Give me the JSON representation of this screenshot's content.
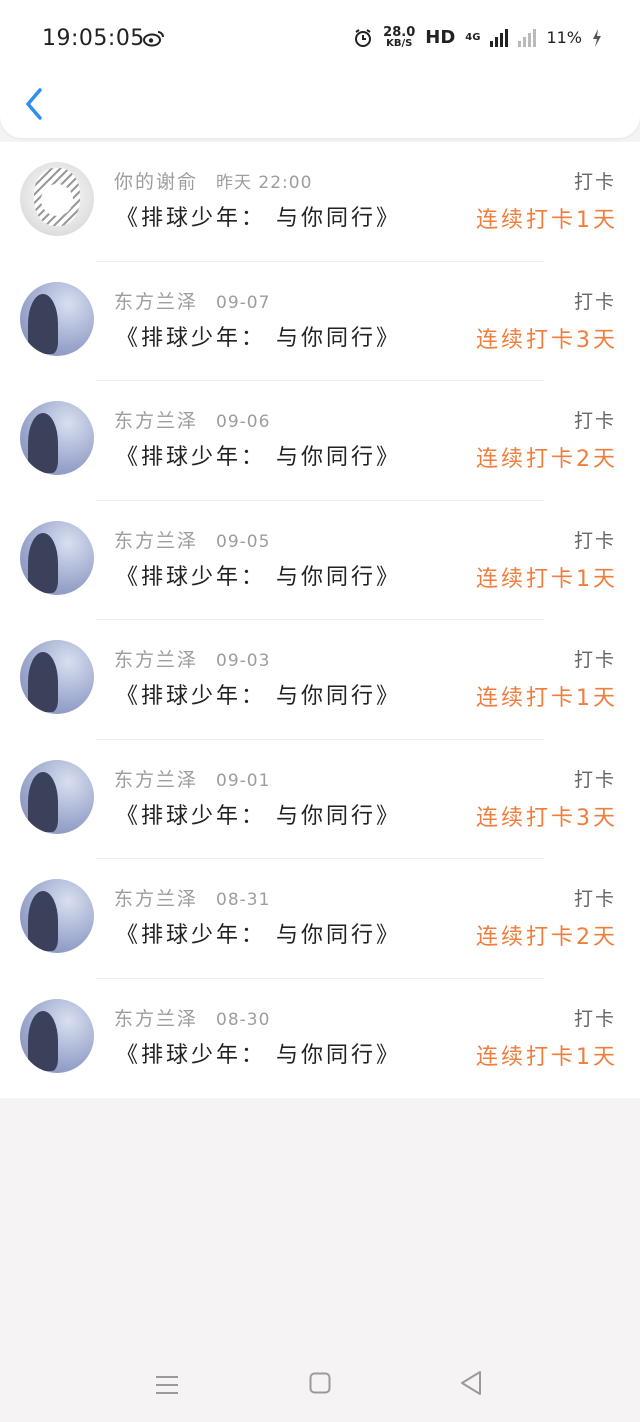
{
  "status_bar": {
    "time": "19:05:05",
    "net_speed": "28.0",
    "net_unit": "KB/S",
    "hd": "HD",
    "network": "4G",
    "battery": "11%"
  },
  "list": [
    {
      "user": "你的谢俞",
      "date": "昨天 22:00",
      "title": "《排球少年： 与你同行》",
      "kind": "打卡",
      "streak": "连续打卡1天"
    },
    {
      "user": "东方兰泽",
      "date": "09-07",
      "title": "《排球少年： 与你同行》",
      "kind": "打卡",
      "streak": "连续打卡3天"
    },
    {
      "user": "东方兰泽",
      "date": "09-06",
      "title": "《排球少年： 与你同行》",
      "kind": "打卡",
      "streak": "连续打卡2天"
    },
    {
      "user": "东方兰泽",
      "date": "09-05",
      "title": "《排球少年： 与你同行》",
      "kind": "打卡",
      "streak": "连续打卡1天"
    },
    {
      "user": "东方兰泽",
      "date": "09-03",
      "title": "《排球少年： 与你同行》",
      "kind": "打卡",
      "streak": "连续打卡1天"
    },
    {
      "user": "东方兰泽",
      "date": "09-01",
      "title": "《排球少年： 与你同行》",
      "kind": "打卡",
      "streak": "连续打卡3天"
    },
    {
      "user": "东方兰泽",
      "date": "08-31",
      "title": "《排球少年： 与你同行》",
      "kind": "打卡",
      "streak": "连续打卡2天"
    },
    {
      "user": "东方兰泽",
      "date": "08-30",
      "title": "《排球少年： 与你同行》",
      "kind": "打卡",
      "streak": "连续打卡1天"
    }
  ],
  "colors": {
    "accent": "#2f8ff0",
    "streak": "#f07d3b",
    "meta": "#9d9d9d"
  },
  "icons": {
    "back": "chevron-left-icon",
    "nav_menu": "menu-icon",
    "nav_home": "home-square-icon",
    "nav_back": "triangle-back-icon"
  }
}
